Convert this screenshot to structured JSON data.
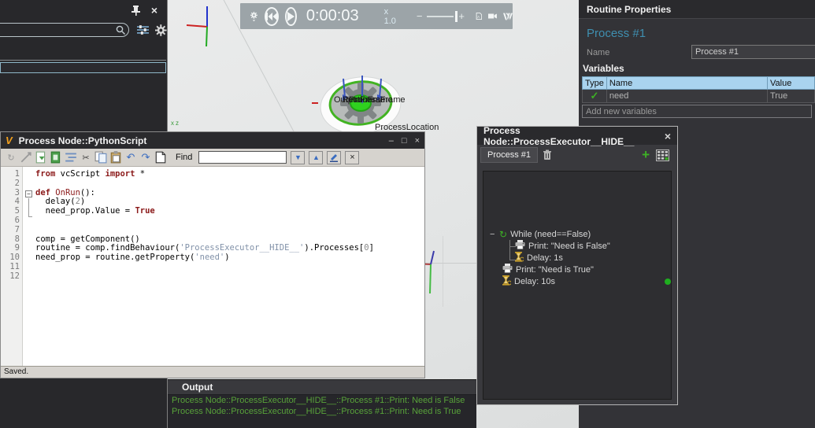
{
  "left_panel": {
    "search_value": ""
  },
  "viewport": {
    "playback": {
      "time": "0:00:03",
      "speed": "x 1.0"
    },
    "frame_labels": [
      "OutputFrame",
      "RetainFrame",
      "ProcessFrame"
    ],
    "location_label": "ProcessLocation",
    "axis_label": "xz"
  },
  "routine_properties": {
    "title": "Routine Properties",
    "process_title": "Process #1",
    "name_label": "Name",
    "name_value": "Process #1",
    "variables_label": "Variables",
    "table": {
      "headers": [
        "Type",
        "Name",
        "Value"
      ],
      "rows": [
        {
          "type_icon": "check-icon",
          "name": "need",
          "value": "True"
        }
      ]
    },
    "add_placeholder": "Add new variables"
  },
  "python_window": {
    "title": "Process Node::PythonScript",
    "logo": "V",
    "find_label": "Find",
    "find_value": "",
    "status": "Saved.",
    "window_buttons": {
      "minimize": "–",
      "maximize": "□",
      "close": "×"
    },
    "code": [
      {
        "n": "1",
        "tokens": [
          [
            "kw",
            "from"
          ],
          [
            "pl",
            " vcScript "
          ],
          [
            "kw",
            "import"
          ],
          [
            "pl",
            " *"
          ]
        ]
      },
      {
        "n": "2",
        "tokens": []
      },
      {
        "n": "3",
        "tokens": [
          [
            "kw",
            "def"
          ],
          [
            "pl",
            " "
          ],
          [
            "fn",
            "OnRun"
          ],
          [
            "pl",
            "():"
          ]
        ]
      },
      {
        "n": "4",
        "tokens": [
          [
            "pl",
            "  delay("
          ],
          [
            "num",
            "2"
          ],
          [
            "pl",
            ")"
          ]
        ]
      },
      {
        "n": "5",
        "tokens": [
          [
            "pl",
            "  need_prop.Value = "
          ],
          [
            "kw",
            "True"
          ]
        ]
      },
      {
        "n": "6",
        "tokens": []
      },
      {
        "n": "7",
        "tokens": []
      },
      {
        "n": "8",
        "tokens": [
          [
            "pl",
            "comp = getComponent()"
          ]
        ]
      },
      {
        "n": "9",
        "tokens": [
          [
            "pl",
            "routine = comp.findBehaviour("
          ],
          [
            "str",
            "'ProcessExecutor__HIDE__'"
          ],
          [
            "pl",
            ").Processes["
          ],
          [
            "num",
            "0"
          ],
          [
            "pl",
            "]"
          ]
        ]
      },
      {
        "n": "10",
        "tokens": [
          [
            "pl",
            "need_prop = routine.getProperty("
          ],
          [
            "str",
            "'need'"
          ],
          [
            "pl",
            ")"
          ]
        ]
      },
      {
        "n": "11",
        "tokens": []
      },
      {
        "n": "12",
        "tokens": []
      }
    ]
  },
  "executor_window": {
    "title": "Process Node::ProcessExecutor__HIDE__",
    "close": "×",
    "tab": "Process #1",
    "tree": [
      {
        "icon": "loop-icon",
        "expander": "−",
        "label": "While (need==False)",
        "indent": 0
      },
      {
        "icon": "print-icon",
        "label": "Print: \"Need is False\"",
        "indent": 1
      },
      {
        "icon": "delay-icon",
        "label": "Delay: 1s",
        "indent": 1
      },
      {
        "icon": "print-icon",
        "label": "Print: \"Need is True\"",
        "indent": 2
      },
      {
        "icon": "delay-icon",
        "label": "Delay: 10s",
        "indent": 2,
        "active": true
      }
    ]
  },
  "output_panel": {
    "title": "Output",
    "lines": [
      "Process Node::ProcessExecutor__HIDE__::Process #1::Print: Need is False",
      "Process Node::ProcessExecutor__HIDE__::Process #1::Print: Need is True"
    ]
  },
  "icons": {
    "loop_glyph": "↻",
    "check_glyph": "✓",
    "plus_glyph": "+",
    "scissors_glyph": "✂",
    "undo_glyph": "↶",
    "redo_glyph": "↷",
    "find_next": "▼",
    "find_prev": "▲",
    "find_clear": "×",
    "pb_minus": "−",
    "pb_plus": "+"
  },
  "colors": {
    "table_header_blue": "#a9d3ee",
    "process_title_blue": "#3f8fb0",
    "output_green": "#58a23a",
    "active_dot_green": "#1fae1f",
    "keyword_maroon": "#8b1a1a",
    "string_gray_blue": "#8191a8",
    "vc_orange": "#f2a01e"
  }
}
